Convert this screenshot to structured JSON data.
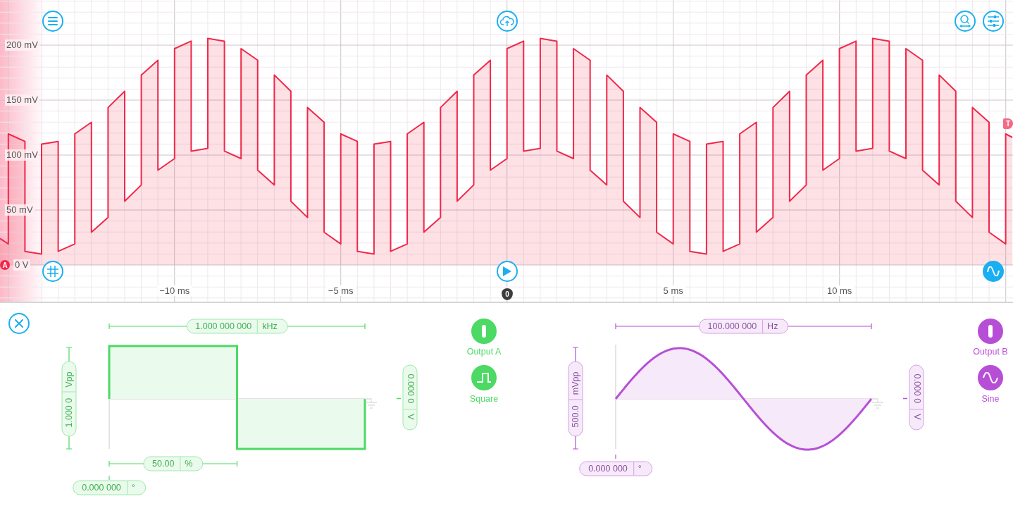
{
  "scope": {
    "chart_data": {
      "type": "line",
      "grid": true,
      "xlim": [
        -15.25,
        15.22
      ],
      "ylim": [
        -33.3,
        241
      ],
      "yticks": [
        {
          "value": 200,
          "label": "200 mV"
        },
        {
          "value": 150,
          "label": "150 mV"
        },
        {
          "value": 100,
          "label": "100 mV"
        },
        {
          "value": 50,
          "label": "50 mV"
        },
        {
          "value": 0,
          "label": "0 V"
        }
      ],
      "xticks": [
        {
          "value": -10,
          "label": "−10 ms"
        },
        {
          "value": -5,
          "label": "−5 ms"
        },
        {
          "value": 5,
          "label": "5 ms"
        },
        {
          "value": 10,
          "label": "10 ms"
        }
      ],
      "x": [
        -15.25,
        -15,
        -15,
        -14.5,
        -14.5,
        -14,
        -14,
        -13.5,
        -13.5,
        -13,
        -13,
        -12.5,
        -12.5,
        -12,
        -12,
        -11.5,
        -11.5,
        -11,
        -11,
        -10.5,
        -10.5,
        -10,
        -10,
        -9.5,
        -9.5,
        -9,
        -9,
        -8.5,
        -8.5,
        -8,
        -8,
        -7.5,
        -7.5,
        -7,
        -7,
        -6.5,
        -6.5,
        -6,
        -6,
        -5.5,
        -5.5,
        -5,
        -5,
        -4.5,
        -4.5,
        -4,
        -4,
        -3.5,
        -3.5,
        -3,
        -3,
        -2.5,
        -2.5,
        -2,
        -2,
        -1.5,
        -1.5,
        -1,
        -1,
        -0.5,
        -0.5,
        0,
        0,
        0.5,
        0.5,
        1,
        1,
        1.5,
        1.5,
        2,
        2,
        2.5,
        2.5,
        3,
        3,
        3.5,
        3.5,
        4,
        4,
        4.5,
        4.5,
        5,
        5,
        5.5,
        5.5,
        6,
        6,
        6.5,
        6.5,
        7,
        7,
        7.5,
        7.5,
        8,
        8,
        8.5,
        8.5,
        9,
        9,
        9.5,
        9.5,
        10,
        10,
        10.5,
        10.5,
        11,
        11,
        11.5,
        11.5,
        12,
        12,
        12.5,
        12.5,
        13,
        13,
        13.5,
        13.5,
        14,
        14,
        14.5,
        14.5,
        15,
        15,
        15.2
      ],
      "series": [
        {
          "color": "#f0284a",
          "values": [
            24.1,
            19.2,
            119.2,
            112.4,
            12.4,
            10,
            110,
            112.4,
            12.4,
            19.2,
            119.2,
            129.8,
            29.8,
            43.2,
            143.2,
            158,
            58,
            72.8,
            172.8,
            186.2,
            86.2,
            96.8,
            196.8,
            203.6,
            103.6,
            106,
            206,
            203.6,
            103.6,
            96.8,
            196.8,
            186.2,
            86.2,
            72.8,
            172.8,
            158,
            58,
            43.2,
            143.2,
            129.8,
            29.8,
            19.2,
            119.2,
            112.4,
            12.4,
            10,
            110,
            112.4,
            12.4,
            19.2,
            119.2,
            129.8,
            29.8,
            43.2,
            143.2,
            158,
            58,
            72.8,
            172.8,
            186.2,
            86.2,
            96.8,
            196.8,
            203.6,
            103.6,
            106,
            206,
            203.6,
            103.6,
            96.8,
            196.8,
            186.2,
            86.2,
            72.8,
            172.8,
            158,
            58,
            43.2,
            143.2,
            129.8,
            29.8,
            19.2,
            119.2,
            112.4,
            12.4,
            10,
            110,
            112.4,
            12.4,
            19.2,
            119.2,
            129.8,
            29.8,
            43.2,
            143.2,
            158,
            58,
            72.8,
            172.8,
            186.2,
            86.2,
            96.8,
            196.8,
            203.6,
            103.6,
            106,
            206,
            203.6,
            103.6,
            96.8,
            196.8,
            186.2,
            86.2,
            72.8,
            172.8,
            158,
            58,
            43.2,
            143.2,
            129.8,
            29.8,
            19.2,
            119.2,
            116
          ]
        }
      ]
    },
    "channel_marker": "A",
    "trigger_marker": "T",
    "time_marker": "0"
  },
  "generators": [
    {
      "kind": "square",
      "color": "#4cd964",
      "frequency": {
        "value": "1.000 000 000",
        "unit": "kHz"
      },
      "amplitude": {
        "value": "1.000 0",
        "unit": "Vpp"
      },
      "duty_cycle": {
        "value": "50.00",
        "unit": "%"
      },
      "phase": {
        "value": "0.000 000",
        "unit": "°"
      },
      "offset": {
        "value": "0.000 0",
        "unit": "V"
      },
      "output": {
        "label": "Output A",
        "on": true
      },
      "waveform_label": "Square"
    },
    {
      "kind": "sine",
      "color": "#b74fd6",
      "frequency": {
        "value": "100.000 000",
        "unit": "Hz"
      },
      "amplitude": {
        "value": "500.0",
        "unit": "mVpp"
      },
      "phase": {
        "value": "0.000 000",
        "unit": "°"
      },
      "offset": {
        "value": "0.000 0",
        "unit": "V"
      },
      "output": {
        "label": "Output B",
        "on": true
      },
      "waveform_label": "Sine"
    }
  ]
}
